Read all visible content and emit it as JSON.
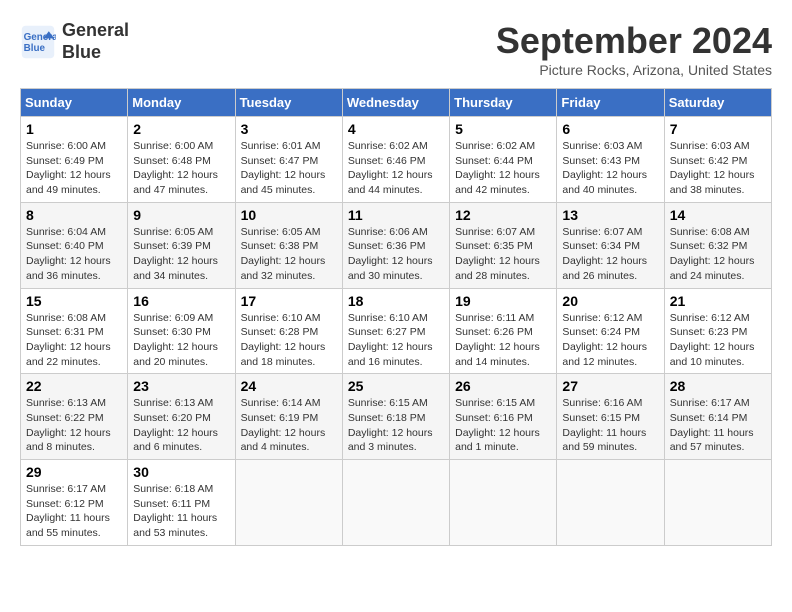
{
  "header": {
    "logo_line1": "General",
    "logo_line2": "Blue",
    "month": "September 2024",
    "location": "Picture Rocks, Arizona, United States"
  },
  "weekdays": [
    "Sunday",
    "Monday",
    "Tuesday",
    "Wednesday",
    "Thursday",
    "Friday",
    "Saturday"
  ],
  "weeks": [
    [
      {
        "day": "1",
        "sunrise": "Sunrise: 6:00 AM",
        "sunset": "Sunset: 6:49 PM",
        "daylight": "Daylight: 12 hours and 49 minutes."
      },
      {
        "day": "2",
        "sunrise": "Sunrise: 6:00 AM",
        "sunset": "Sunset: 6:48 PM",
        "daylight": "Daylight: 12 hours and 47 minutes."
      },
      {
        "day": "3",
        "sunrise": "Sunrise: 6:01 AM",
        "sunset": "Sunset: 6:47 PM",
        "daylight": "Daylight: 12 hours and 45 minutes."
      },
      {
        "day": "4",
        "sunrise": "Sunrise: 6:02 AM",
        "sunset": "Sunset: 6:46 PM",
        "daylight": "Daylight: 12 hours and 44 minutes."
      },
      {
        "day": "5",
        "sunrise": "Sunrise: 6:02 AM",
        "sunset": "Sunset: 6:44 PM",
        "daylight": "Daylight: 12 hours and 42 minutes."
      },
      {
        "day": "6",
        "sunrise": "Sunrise: 6:03 AM",
        "sunset": "Sunset: 6:43 PM",
        "daylight": "Daylight: 12 hours and 40 minutes."
      },
      {
        "day": "7",
        "sunrise": "Sunrise: 6:03 AM",
        "sunset": "Sunset: 6:42 PM",
        "daylight": "Daylight: 12 hours and 38 minutes."
      }
    ],
    [
      {
        "day": "8",
        "sunrise": "Sunrise: 6:04 AM",
        "sunset": "Sunset: 6:40 PM",
        "daylight": "Daylight: 12 hours and 36 minutes."
      },
      {
        "day": "9",
        "sunrise": "Sunrise: 6:05 AM",
        "sunset": "Sunset: 6:39 PM",
        "daylight": "Daylight: 12 hours and 34 minutes."
      },
      {
        "day": "10",
        "sunrise": "Sunrise: 6:05 AM",
        "sunset": "Sunset: 6:38 PM",
        "daylight": "Daylight: 12 hours and 32 minutes."
      },
      {
        "day": "11",
        "sunrise": "Sunrise: 6:06 AM",
        "sunset": "Sunset: 6:36 PM",
        "daylight": "Daylight: 12 hours and 30 minutes."
      },
      {
        "day": "12",
        "sunrise": "Sunrise: 6:07 AM",
        "sunset": "Sunset: 6:35 PM",
        "daylight": "Daylight: 12 hours and 28 minutes."
      },
      {
        "day": "13",
        "sunrise": "Sunrise: 6:07 AM",
        "sunset": "Sunset: 6:34 PM",
        "daylight": "Daylight: 12 hours and 26 minutes."
      },
      {
        "day": "14",
        "sunrise": "Sunrise: 6:08 AM",
        "sunset": "Sunset: 6:32 PM",
        "daylight": "Daylight: 12 hours and 24 minutes."
      }
    ],
    [
      {
        "day": "15",
        "sunrise": "Sunrise: 6:08 AM",
        "sunset": "Sunset: 6:31 PM",
        "daylight": "Daylight: 12 hours and 22 minutes."
      },
      {
        "day": "16",
        "sunrise": "Sunrise: 6:09 AM",
        "sunset": "Sunset: 6:30 PM",
        "daylight": "Daylight: 12 hours and 20 minutes."
      },
      {
        "day": "17",
        "sunrise": "Sunrise: 6:10 AM",
        "sunset": "Sunset: 6:28 PM",
        "daylight": "Daylight: 12 hours and 18 minutes."
      },
      {
        "day": "18",
        "sunrise": "Sunrise: 6:10 AM",
        "sunset": "Sunset: 6:27 PM",
        "daylight": "Daylight: 12 hours and 16 minutes."
      },
      {
        "day": "19",
        "sunrise": "Sunrise: 6:11 AM",
        "sunset": "Sunset: 6:26 PM",
        "daylight": "Daylight: 12 hours and 14 minutes."
      },
      {
        "day": "20",
        "sunrise": "Sunrise: 6:12 AM",
        "sunset": "Sunset: 6:24 PM",
        "daylight": "Daylight: 12 hours and 12 minutes."
      },
      {
        "day": "21",
        "sunrise": "Sunrise: 6:12 AM",
        "sunset": "Sunset: 6:23 PM",
        "daylight": "Daylight: 12 hours and 10 minutes."
      }
    ],
    [
      {
        "day": "22",
        "sunrise": "Sunrise: 6:13 AM",
        "sunset": "Sunset: 6:22 PM",
        "daylight": "Daylight: 12 hours and 8 minutes."
      },
      {
        "day": "23",
        "sunrise": "Sunrise: 6:13 AM",
        "sunset": "Sunset: 6:20 PM",
        "daylight": "Daylight: 12 hours and 6 minutes."
      },
      {
        "day": "24",
        "sunrise": "Sunrise: 6:14 AM",
        "sunset": "Sunset: 6:19 PM",
        "daylight": "Daylight: 12 hours and 4 minutes."
      },
      {
        "day": "25",
        "sunrise": "Sunrise: 6:15 AM",
        "sunset": "Sunset: 6:18 PM",
        "daylight": "Daylight: 12 hours and 3 minutes."
      },
      {
        "day": "26",
        "sunrise": "Sunrise: 6:15 AM",
        "sunset": "Sunset: 6:16 PM",
        "daylight": "Daylight: 12 hours and 1 minute."
      },
      {
        "day": "27",
        "sunrise": "Sunrise: 6:16 AM",
        "sunset": "Sunset: 6:15 PM",
        "daylight": "Daylight: 11 hours and 59 minutes."
      },
      {
        "day": "28",
        "sunrise": "Sunrise: 6:17 AM",
        "sunset": "Sunset: 6:14 PM",
        "daylight": "Daylight: 11 hours and 57 minutes."
      }
    ],
    [
      {
        "day": "29",
        "sunrise": "Sunrise: 6:17 AM",
        "sunset": "Sunset: 6:12 PM",
        "daylight": "Daylight: 11 hours and 55 minutes."
      },
      {
        "day": "30",
        "sunrise": "Sunrise: 6:18 AM",
        "sunset": "Sunset: 6:11 PM",
        "daylight": "Daylight: 11 hours and 53 minutes."
      },
      null,
      null,
      null,
      null,
      null
    ]
  ]
}
